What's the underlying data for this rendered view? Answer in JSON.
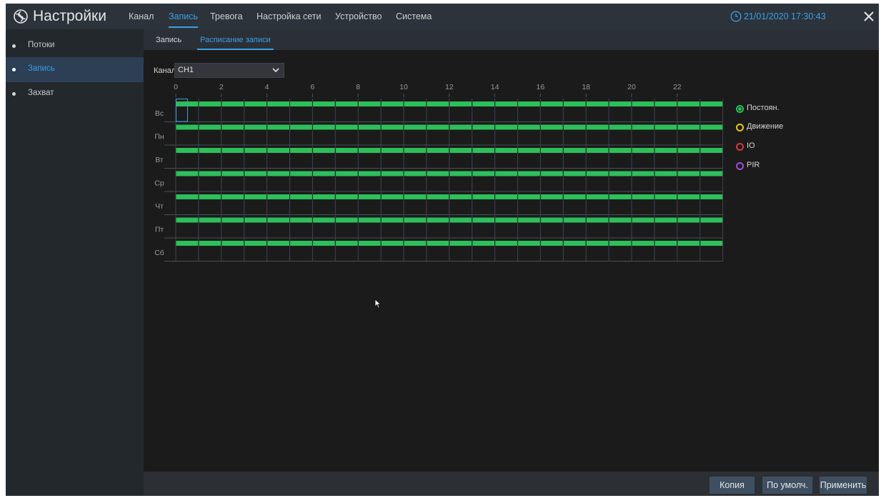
{
  "header": {
    "title": "Настройки",
    "tabs": [
      {
        "label": "Канал",
        "active": false
      },
      {
        "label": "Запись",
        "active": true
      },
      {
        "label": "Тревога",
        "active": false
      },
      {
        "label": "Настройка сети",
        "active": false
      },
      {
        "label": "Устройство",
        "active": false
      },
      {
        "label": "Система",
        "active": false
      }
    ],
    "datetime": "21/01/2020 17:30:43"
  },
  "sidebar": {
    "items": [
      {
        "label": "Потоки",
        "active": false
      },
      {
        "label": "Запись",
        "active": true
      },
      {
        "label": "Захват",
        "active": false
      }
    ]
  },
  "subtabs": [
    {
      "label": "Запись",
      "active": false
    },
    {
      "label": "Расписание записи",
      "active": true
    }
  ],
  "channel": {
    "label": "Канал",
    "value": "CH1"
  },
  "schedule": {
    "hour_labels": [
      "0",
      "2",
      "4",
      "6",
      "8",
      "10",
      "12",
      "14",
      "16",
      "18",
      "20",
      "22"
    ],
    "days": [
      {
        "label": "Вс",
        "constant_hours": [
          0,
          24
        ]
      },
      {
        "label": "Пн",
        "constant_hours": [
          0,
          24
        ]
      },
      {
        "label": "Вт",
        "constant_hours": [
          0,
          24
        ]
      },
      {
        "label": "Ср",
        "constant_hours": [
          0,
          24
        ]
      },
      {
        "label": "Чт",
        "constant_hours": [
          0,
          24
        ]
      },
      {
        "label": "Пт",
        "constant_hours": [
          0,
          24
        ]
      },
      {
        "label": "Сб",
        "constant_hours": [
          0,
          24
        ]
      }
    ],
    "selected_day": "Вс",
    "selected_hour": 0
  },
  "legend": [
    {
      "label": "Постоян.",
      "color": "#2dbf5b",
      "selected": true
    },
    {
      "label": "Движение",
      "color": "#e6c619",
      "selected": false
    },
    {
      "label": "IO",
      "color": "#d23a3a",
      "selected": false
    },
    {
      "label": "PIR",
      "color": "#9b4fd6",
      "selected": false
    }
  ],
  "buttons": {
    "copy": "Копия",
    "default": "По умолч.",
    "apply": "Применить"
  },
  "colors": {
    "accent": "#3aa0e6",
    "record_bar": "#2dbf5b"
  }
}
